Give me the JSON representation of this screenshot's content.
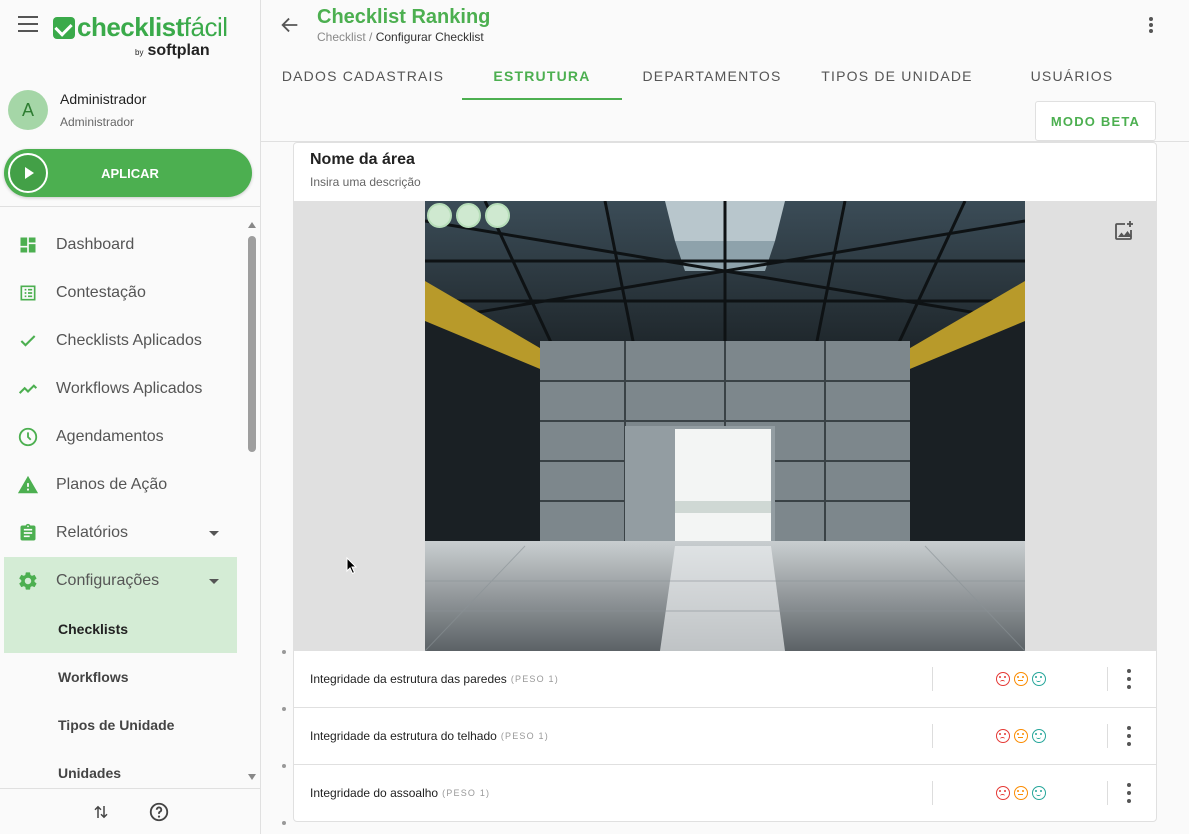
{
  "brand": {
    "logo_main": "checklist",
    "logo_light": "fácil",
    "logo_by": "by",
    "logo_company": "softplan",
    "accent": "#4caf50"
  },
  "user": {
    "initial": "A",
    "name": "Administrador",
    "role": "Administrador"
  },
  "apply_button": {
    "label": "APLICAR"
  },
  "nav": {
    "items": [
      {
        "label": "Dashboard",
        "icon": "dashboard-icon"
      },
      {
        "label": "Contestação",
        "icon": "list-icon"
      },
      {
        "label": "Checklists Aplicados",
        "icon": "check-icon"
      },
      {
        "label": "Workflows Aplicados",
        "icon": "trending-icon"
      },
      {
        "label": "Agendamentos",
        "icon": "clock-icon"
      },
      {
        "label": "Planos de Ação",
        "icon": "warning-icon"
      },
      {
        "label": "Relatórios",
        "icon": "clipboard-icon"
      },
      {
        "label": "Configurações",
        "icon": "gear-icon"
      }
    ],
    "sub_items": [
      {
        "label": "Checklists"
      },
      {
        "label": "Workflows"
      },
      {
        "label": "Tipos de Unidade"
      },
      {
        "label": "Unidades"
      }
    ]
  },
  "footer": {
    "icons": [
      "sort-arrows-icon",
      "help-icon"
    ]
  },
  "header": {
    "title": "Checklist Ranking",
    "breadcrumb_parent": "Checklist",
    "breadcrumb_sep": " / ",
    "breadcrumb_current": "Configurar Checklist"
  },
  "tabs": [
    {
      "label": "DADOS CADASTRAIS"
    },
    {
      "label": "ESTRUTURA"
    },
    {
      "label": "DEPARTAMENTOS"
    },
    {
      "label": "TIPOS DE UNIDADE"
    },
    {
      "label": "USUÁRIOS"
    }
  ],
  "beta_button": {
    "label": "MODO BETA"
  },
  "area": {
    "title": "Nome da área",
    "description": "Insira uma descrição"
  },
  "questions": [
    {
      "text": "Integridade da estrutura das paredes",
      "weight": "(PESO 1)"
    },
    {
      "text": "Integridade da estrutura do telhado",
      "weight": "(PESO 1)"
    },
    {
      "text": "Integridade do assoalho",
      "weight": "(PESO 1)"
    }
  ]
}
